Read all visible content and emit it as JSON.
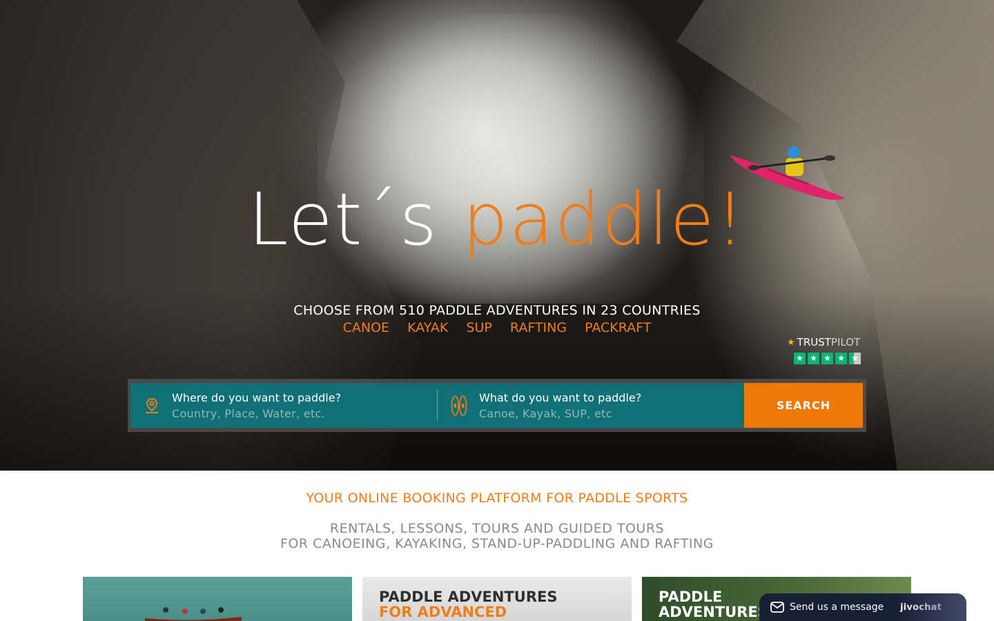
{
  "hero": {
    "headline_main": "Let´s",
    "headline_accent": "paddle!",
    "tagline": "CHOOSE FROM 510 PADDLE ADVENTURES IN 23 COUNTRIES",
    "categories": [
      "CANOE",
      "KAYAK",
      "SUP",
      "RAFTING",
      "PACKRAFT"
    ]
  },
  "trustpilot": {
    "name_bold": "TRUST",
    "name_light": "PILOT",
    "rating_stars": 4.5,
    "max_stars": 5
  },
  "search": {
    "where_label": "Where do you want to paddle?",
    "where_placeholder": "Country, Place, Water, etc.",
    "what_label": "What do you want to paddle?",
    "what_placeholder": "Canoe, Kayak, SUP, etc",
    "button_label": "SEARCH"
  },
  "intro": {
    "title": "YOUR ONLINE BOOKING PLATFORM FOR PADDLE SPORTS",
    "subtitle_line1": "RENTALS, LESSONS, TOURS AND GUIDED TOURS",
    "subtitle_line2": "FOR CANOEING, KAYAKING, STAND-UP-PADDLING AND RAFTING"
  },
  "cards": [
    {
      "title_line1": "",
      "title_line2": ""
    },
    {
      "title_line1": "PADDLE ADVENTURES",
      "title_line2": "FOR ADVANCED"
    },
    {
      "title_line1": "PADDLE",
      "title_line2": "ADVENTURES"
    }
  ],
  "chat": {
    "message_label": "Send us a message",
    "brand": "jivochat"
  },
  "colors": {
    "accent": "#ef7d19",
    "search_bg": "#117076",
    "search_button": "#ef7807",
    "trustpilot_green": "#00b67a",
    "chat_bg": "#172035"
  }
}
